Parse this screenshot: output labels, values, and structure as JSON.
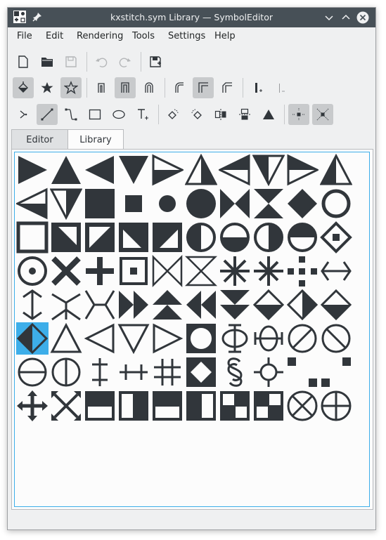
{
  "window": {
    "title": "kxstitch.sym Library  — SymbolEditor"
  },
  "menu": [
    "File",
    "Edit",
    "Rendering",
    "Tools",
    "Settings",
    "Help"
  ],
  "tabs": [
    "Editor",
    "Library"
  ],
  "colors": {
    "symbol": "#31363b",
    "selection": "#3daee9",
    "titlebar": "#475057"
  },
  "symbols": [
    "tri-right",
    "tri-up",
    "tri-left",
    "tri-down",
    "half-tri-right",
    "half-tri-up",
    "half-tri-left",
    "half-tri-down",
    "outline-tri-right",
    "half-tri-up-2",
    "half-tri-left-2",
    "half-tri-down-2",
    "square-filled",
    "square-small",
    "dot",
    "circle-filled",
    "bowtie-h",
    "bowtie-v",
    "diamond-filled",
    "ring",
    "square-outline",
    "square-diag-a",
    "square-diag-b",
    "square-diag-c",
    "square-diag-d",
    "circle-half-left",
    "circle-half-bottom",
    "circle-half-right",
    "circle-half-top",
    "diamond-dot",
    "circle-dot",
    "x-cross",
    "plus-cross",
    "square-dot",
    "bowtie-outline-h",
    "bowtie-outline-v",
    "asterisk",
    "asterisk-bar",
    "dotted-cross",
    "double-arrow-h",
    "double-arrow-v",
    "y-fork-v",
    "y-fork-h",
    "double-tri-right",
    "double-tri-up",
    "double-tri-left",
    "double-tri-down",
    "diamond-half-bottom",
    "diamond-half-right",
    "diamond-half-bottom-2",
    "diamond-half-left",
    "tri-up-outline",
    "tri-left-outline",
    "tri-down-outline",
    "tri-right-outline",
    "square-circle",
    "phi",
    "theta",
    "circle-slash",
    "circle-backslash",
    "circle-hline",
    "circle-vline",
    "double-dagger",
    "double-bar-h",
    "hash",
    "square-diamond",
    "section-sign",
    "crosshair-circle",
    "scattered-squares-a",
    "scattered-squares-b",
    "four-arrows",
    "x-arrows",
    "square-half-top",
    "square-half-left",
    "square-half-top-2",
    "square-half-right",
    "checker-a",
    "checker-b",
    "circle-x",
    "circle-plus"
  ]
}
